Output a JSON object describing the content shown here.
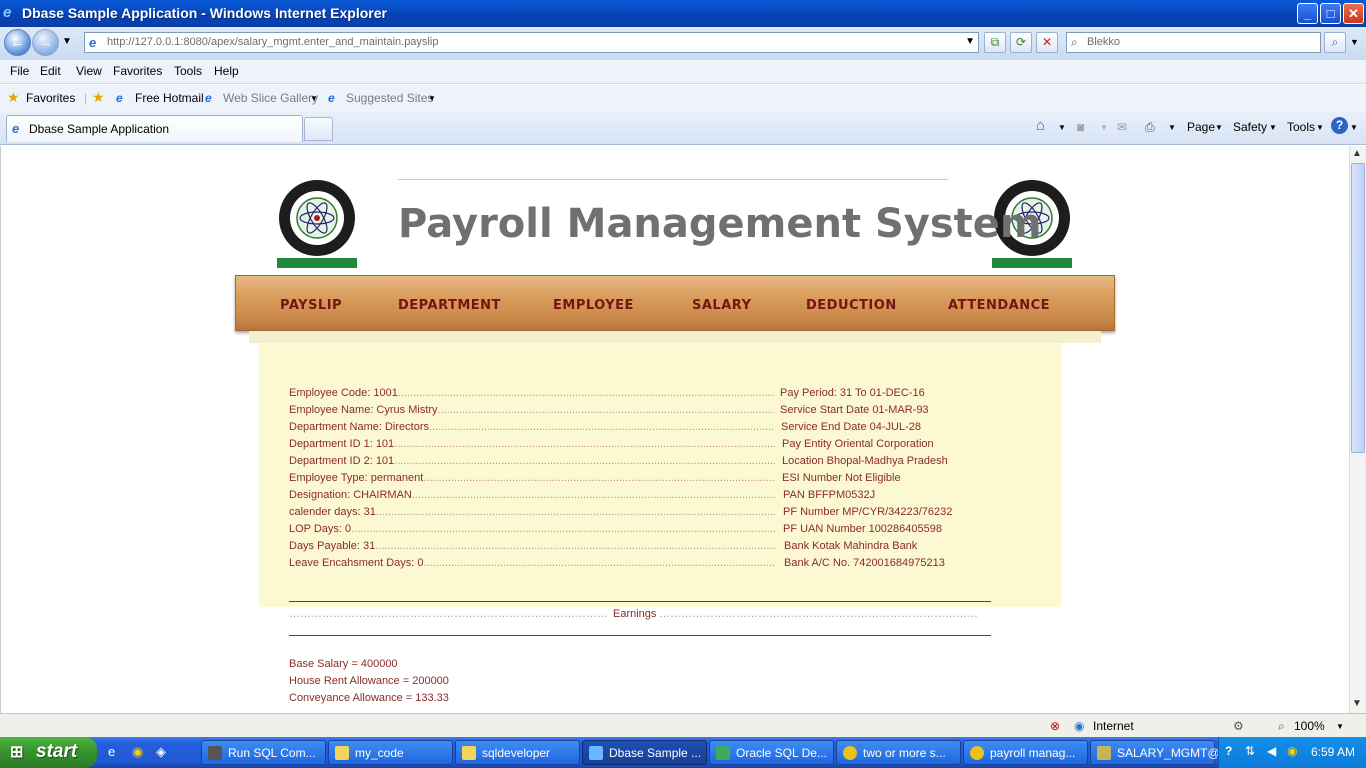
{
  "window": {
    "title": "Dbase Sample Application - Windows Internet Explorer",
    "min": "_",
    "max": "□",
    "close": "✕"
  },
  "address": {
    "url": "http://127.0.0.1:8080/apex/salary_mgmt.enter_and_maintain.payslip",
    "search_placeholder": "Blekko"
  },
  "menu": [
    "File",
    "Edit",
    "View",
    "Favorites",
    "Tools",
    "Help"
  ],
  "favbar": {
    "favorites": "Favorites",
    "hotmail": "Free Hotmail",
    "webslice": "Web Slice Gallery",
    "suggested": "Suggested Sites"
  },
  "tab": {
    "label": "Dbase Sample Application"
  },
  "commandbar": {
    "page": "Page",
    "safety": "Safety",
    "tools": "Tools"
  },
  "page": {
    "title": "Payroll Management System",
    "nav": [
      "PAYSLIP",
      "DEPARTMENT",
      "EMPLOYEE",
      "SALARY",
      "DEDUCTION",
      "ATTENDANCE"
    ],
    "left_rows": [
      "Employee Code: 1001",
      "Employee Name: Cyrus Mistry",
      "Department Name: Directors",
      "Department ID 1: 101",
      "Department ID 2: 101",
      "Employee Type: permanent",
      "Designation: CHAIRMAN",
      "calender days: 31",
      "LOP Days: 0",
      "Days Payable: 31",
      "Leave Encahsment Days: 0"
    ],
    "right_rows": [
      "Pay Period: 31 To 01-DEC-16",
      "Service Start Date 01-MAR-93",
      "Service End Date 04-JUL-28",
      "Pay Entity Oriental Corporation",
      "Location Bhopal-Madhya Pradesh",
      "ESI Number Not Eligible",
      "PAN BFFPM0532J",
      "PF Number MP/CYR/34223/76232",
      "PF UAN Number 100286405598",
      "Bank Kotak Mahindra Bank",
      "Bank A/C No. 742001684975213"
    ],
    "earnings_heading": "Earnings",
    "earnings": [
      "Base Salary = 400000",
      "House Rent Allowance = 200000",
      "Conveyance Allowance = 133.33"
    ]
  },
  "status": {
    "zone": "Internet",
    "zoom": "100%"
  },
  "taskbar": {
    "start": "start",
    "items": [
      "Run SQL Com...",
      "my_code",
      "sqldeveloper",
      "Dbase Sample ...",
      "Oracle SQL De...",
      "two or more s...",
      "payroll manag...",
      "SALARY_MGMT@"
    ],
    "clock": "6:59 AM"
  }
}
